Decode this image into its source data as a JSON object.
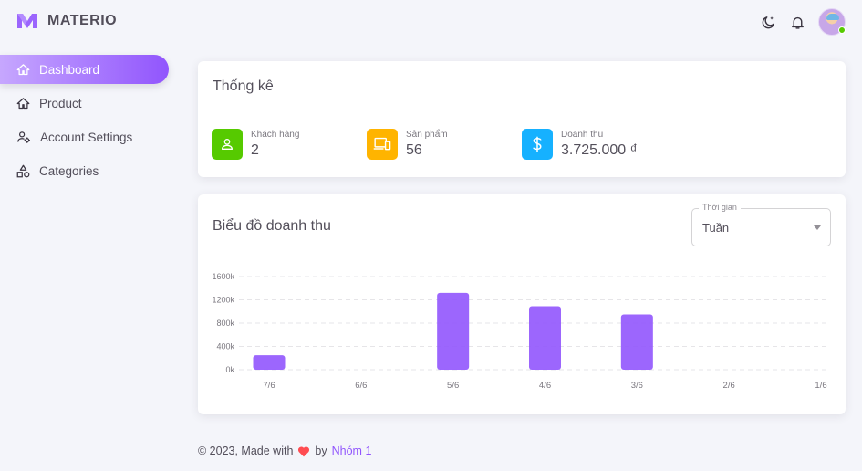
{
  "app": {
    "name": "MATERIO"
  },
  "colors": {
    "primary": "#9155fd",
    "success": "#56ca00",
    "warning": "#ffb400",
    "info": "#16b1ff"
  },
  "sidebar": {
    "items": [
      {
        "label": "Dashboard",
        "icon": "home-icon",
        "active": true
      },
      {
        "label": "Product",
        "icon": "home-icon",
        "active": false
      },
      {
        "label": "Account Settings",
        "icon": "account-cog-icon",
        "active": false
      },
      {
        "label": "Categories",
        "icon": "shapes-icon",
        "active": false
      }
    ]
  },
  "header": {
    "icons": [
      "theme-toggle-icon",
      "bell-icon",
      "avatar"
    ]
  },
  "stats": {
    "title": "Thống kê",
    "items": [
      {
        "label": "Khách hàng",
        "value": "2",
        "icon": "account-icon",
        "color": "#56ca00"
      },
      {
        "label": "Sản phẩm",
        "value": "56",
        "icon": "devices-icon",
        "color": "#ffb400"
      },
      {
        "label": "Doanh thu",
        "value": "3.725.000 ₫",
        "icon": "dollar-icon",
        "color": "#16b1ff"
      }
    ]
  },
  "revenue": {
    "title": "Biểu đồ doanh thu",
    "select": {
      "label": "Thời gian",
      "value": "Tuần"
    }
  },
  "chart_data": {
    "type": "bar",
    "categories": [
      "7/6",
      "6/6",
      "5/6",
      "4/6",
      "3/6",
      "2/6",
      "1/6"
    ],
    "values": [
      250000,
      0,
      1320000,
      1090000,
      950000,
      0,
      0
    ],
    "yticks": [
      "1600k",
      "1200k",
      "800k",
      "400k",
      "0k"
    ],
    "ylim": [
      0,
      1600000
    ],
    "title": "",
    "xlabel": "",
    "ylabel": "",
    "grid": true,
    "color": "#9155fd"
  },
  "footer": {
    "prefix": "© 2023, Made with",
    "by": "by",
    "brand": "Nhóm 1"
  }
}
